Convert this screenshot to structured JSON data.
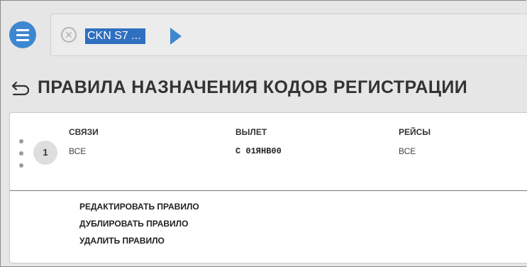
{
  "search": {
    "chip_text": "CKN S7 ..."
  },
  "title": "ПРАВИЛА НАЗНАЧЕНИЯ КОДОВ РЕГИСТРАЦИИ",
  "rule": {
    "number": "1",
    "columns": [
      {
        "header": "СВЯЗИ",
        "value": "ВСЕ"
      },
      {
        "header": "ВЫЛЕТ",
        "value": "С  01ЯНВ00"
      },
      {
        "header": "РЕЙСЫ",
        "value": "ВСЕ"
      }
    ],
    "actions": [
      "РЕДАКТИРОВАТЬ ПРАВИЛО",
      "ДУБЛИРОВАТЬ ПРАВИЛО",
      "УДАЛИТЬ ПРАВИЛО"
    ]
  },
  "colors": {
    "accent": "#3d87d0",
    "selection": "#2f6fc0"
  },
  "icons": [
    "menu-icon",
    "clear-icon",
    "arrow-right-icon",
    "back-arrow-icon",
    "drag-handle-icon"
  ]
}
